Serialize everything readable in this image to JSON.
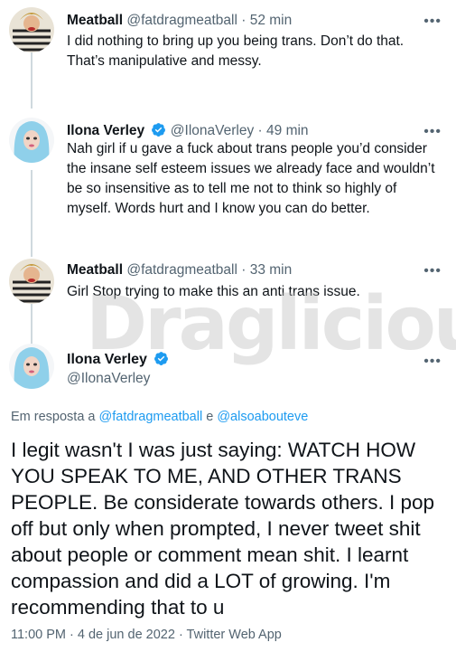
{
  "tweets": [
    {
      "name": "Meatball",
      "handle": "@fatdragmeatball",
      "sep": "·",
      "time": "52 min",
      "text": "I did nothing to bring up you being trans. Don’t do that. That’s manipulative and messy.",
      "more": "•••"
    },
    {
      "name": "Ilona Verley",
      "handle": "@IlonaVerley",
      "sep": "·",
      "time": "49 min",
      "text": "Nah girl if u gave a fuck about trans people you’d consider the insane self esteem issues we already face and wouldn’t be so insensitive as to tell me not to think so highly of myself. Words hurt and I know you can do better.",
      "more": "•••"
    },
    {
      "name": "Meatball",
      "handle": "@fatdragmeatball",
      "sep": "·",
      "time": "33 min",
      "text": "Girl Stop trying to make this an anti trans issue.",
      "more": "•••"
    }
  ],
  "main_tweet": {
    "name": "Ilona Verley",
    "handle": "@IlonaVerley",
    "more": "•••",
    "reply_prefix": "Em resposta a ",
    "reply_user1": "@fatdragmeatball",
    "reply_and": " e ",
    "reply_user2": "@alsoabouteve",
    "text": "I legit wasn't I was just saying: WATCH HOW YOU SPEAK TO ME, AND OTHER TRANS PEOPLE. Be considerate towards others. I pop off but only when prompted, I never tweet shit about people or comment mean shit. I learnt compassion and did a LOT of growing. I'm recommending that to u",
    "meta": "11:00 PM · 4 de jun de 2022 · Twitter Web App"
  },
  "watermark": "Draglicious",
  "colors": {
    "verified": "#1d9bf0",
    "link": "#1d9bf0",
    "secondary": "#536471",
    "thread_line": "#cfd9de"
  },
  "icons": {
    "verified": "verified-badge-icon",
    "more": "more-options-icon"
  }
}
